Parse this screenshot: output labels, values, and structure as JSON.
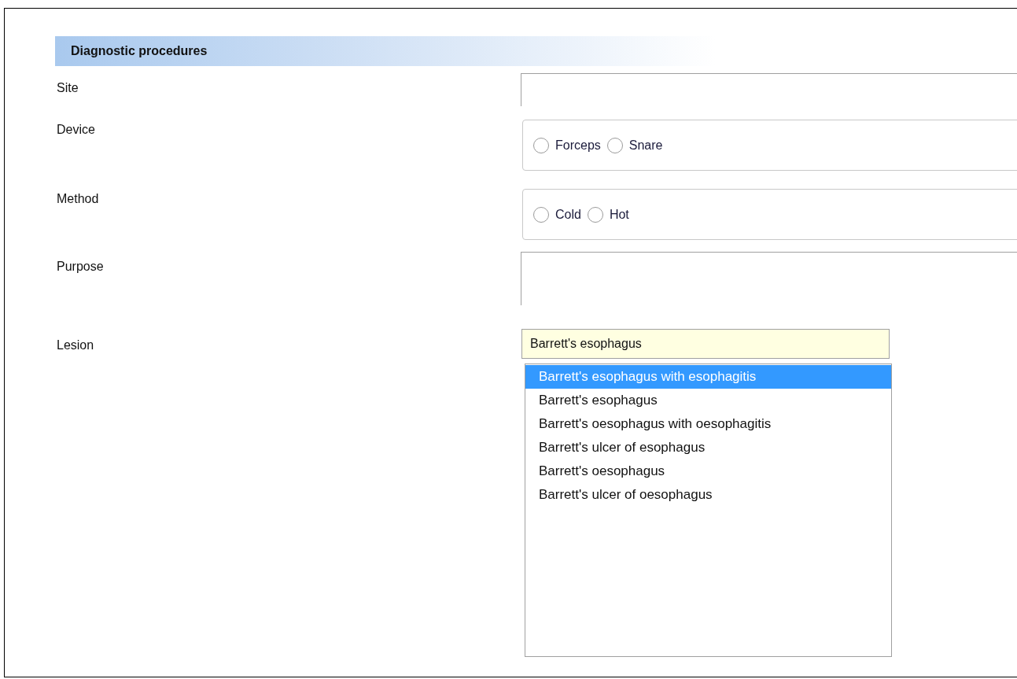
{
  "section": {
    "title": "Diagnostic procedures"
  },
  "fields": [
    {
      "label": "Site",
      "kind": "text"
    },
    {
      "label": "Device",
      "kind": "radio",
      "options": [
        {
          "label": "Forceps",
          "selected": false
        },
        {
          "label": "Snare",
          "selected": false
        }
      ]
    },
    {
      "label": "Method",
      "kind": "radio",
      "options": [
        {
          "label": "Cold",
          "selected": false
        },
        {
          "label": "Hot",
          "selected": false
        }
      ]
    },
    {
      "label": "Purpose",
      "kind": "textarea"
    },
    {
      "label": "Lesion",
      "kind": "combo",
      "value": "Barrett's esophagus",
      "suggestions": [
        {
          "label": "Barrett's esophagus with esophagitis",
          "highlighted": true
        },
        {
          "label": "Barrett's esophagus",
          "highlighted": false
        },
        {
          "label": "Barrett's oesophagus with oesophagitis",
          "highlighted": false
        },
        {
          "label": "Barrett's ulcer of esophagus",
          "highlighted": false
        },
        {
          "label": "Barrett's oesophagus",
          "highlighted": false
        },
        {
          "label": "Barrett's ulcer of oesophagus",
          "highlighted": false
        }
      ]
    }
  ]
}
